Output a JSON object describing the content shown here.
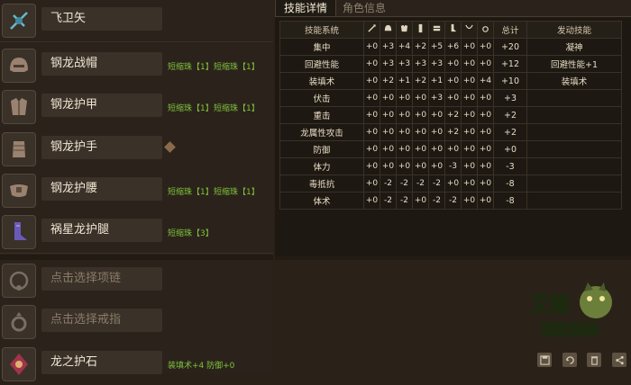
{
  "equipment": [
    {
      "name": "飞卫矢",
      "deco": [],
      "gem": false,
      "icon": "bowgun-icon",
      "empty": false
    },
    {
      "name": "钢龙战帽",
      "deco": [
        "短缩珠【1】",
        "短缩珠【1】"
      ],
      "gem": false,
      "icon": "helmet-icon",
      "empty": false
    },
    {
      "name": "钢龙护甲",
      "deco": [
        "短缩珠【1】",
        "短缩珠【1】"
      ],
      "gem": false,
      "icon": "chest-armor-icon",
      "empty": false
    },
    {
      "name": "钢龙护手",
      "deco": [],
      "gem": true,
      "icon": "gauntlet-icon",
      "empty": false
    },
    {
      "name": "钢龙护腰",
      "deco": [
        "短缩珠【1】",
        "短缩珠【1】"
      ],
      "gem": false,
      "icon": "waist-armor-icon",
      "empty": false
    },
    {
      "name": "祸星龙护腿",
      "deco": [
        "短缩珠【3】"
      ],
      "gem": false,
      "icon": "leg-armor-icon",
      "empty": false
    },
    {
      "name": "点击选择项链",
      "deco": [],
      "gem": false,
      "icon": "necklace-icon",
      "empty": true
    },
    {
      "name": "点击选择戒指",
      "deco": [],
      "gem": false,
      "icon": "ring-icon",
      "empty": true
    },
    {
      "name": "龙之护石",
      "deco": [
        "装填术+4 防御+0"
      ],
      "gem": false,
      "icon": "talisman-icon",
      "empty": false
    }
  ],
  "tabs": {
    "active": "技能详情",
    "inactive": "角色信息"
  },
  "skill_table": {
    "header_label": "技能系统",
    "total_label": "总计",
    "active_label": "发动技能",
    "column_icons": [
      "weapon-icon",
      "helmet-icon",
      "chest-armor-icon",
      "gauntlet-icon",
      "waist-armor-icon",
      "leg-armor-icon",
      "necklace-icon",
      "ring-icon"
    ],
    "rows": [
      {
        "skill": "集中",
        "vals": [
          "+0",
          "+3",
          "+4",
          "+2",
          "+5",
          "+6",
          "+0",
          "+0"
        ],
        "total": "+20",
        "active": "凝神"
      },
      {
        "skill": "回避性能",
        "vals": [
          "+0",
          "+3",
          "+3",
          "+3",
          "+3",
          "+0",
          "+0",
          "+0"
        ],
        "total": "+12",
        "active": "回避性能+1"
      },
      {
        "skill": "装填术",
        "vals": [
          "+0",
          "+2",
          "+1",
          "+2",
          "+1",
          "+0",
          "+0",
          "+4"
        ],
        "total": "+10",
        "active": "装填术"
      },
      {
        "skill": "伏击",
        "vals": [
          "+0",
          "+0",
          "+0",
          "+0",
          "+3",
          "+0",
          "+0",
          "+0"
        ],
        "total": "+3",
        "active": ""
      },
      {
        "skill": "重击",
        "vals": [
          "+0",
          "+0",
          "+0",
          "+0",
          "+0",
          "+2",
          "+0",
          "+0"
        ],
        "total": "+2",
        "active": ""
      },
      {
        "skill": "龙属性攻击",
        "vals": [
          "+0",
          "+0",
          "+0",
          "+0",
          "+0",
          "+2",
          "+0",
          "+0"
        ],
        "total": "+2",
        "active": ""
      },
      {
        "skill": "防御",
        "vals": [
          "+0",
          "+0",
          "+0",
          "+0",
          "+0",
          "+0",
          "+0",
          "+0"
        ],
        "total": "+0",
        "active": ""
      },
      {
        "skill": "体力",
        "vals": [
          "+0",
          "+0",
          "+0",
          "+0",
          "+0",
          "-3",
          "+0",
          "+0"
        ],
        "total": "-3",
        "active": ""
      },
      {
        "skill": "毒抵抗",
        "vals": [
          "+0",
          "-2",
          "-2",
          "-2",
          "-2",
          "+0",
          "+0",
          "+0"
        ],
        "total": "-8",
        "active": ""
      },
      {
        "skill": "体术",
        "vals": [
          "+0",
          "-2",
          "-2",
          "+0",
          "-2",
          "-2",
          "+0",
          "+0"
        ],
        "total": "-8",
        "active": ""
      }
    ]
  },
  "logo": {
    "line1": "艾露",
    "line2": "猫配装器"
  },
  "toolbar": [
    "save-icon",
    "refresh-icon",
    "delete-icon",
    "share-icon"
  ],
  "colors": {
    "deco_green": "#7fc23c",
    "panel": "#2b231b"
  }
}
